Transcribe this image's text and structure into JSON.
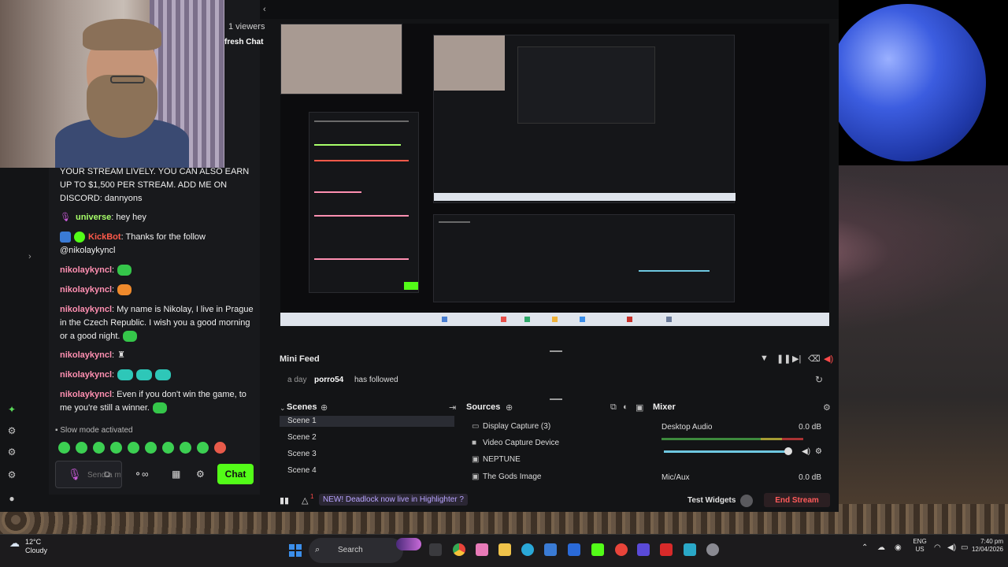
{
  "chat": {
    "viewers": "1 viewers",
    "refresh_label": "fresh Chat",
    "messages": {
      "m0": {
        "text": "YOUR STREAM LIVELY. YOU CAN ALSO EARN UP TO $1,500 PER STREAM. ADD ME ON DISCORD: dannyons"
      },
      "m1": {
        "user": "universe",
        "text": ": hey hey"
      },
      "m2": {
        "user": "KickBot",
        "text": ": Thanks for the follow @nikolaykyncl"
      },
      "m3": {
        "user": "nikolaykyncl",
        "text": ":"
      },
      "m4": {
        "user": "nikolaykyncl",
        "text": ":"
      },
      "m5": {
        "user": "nikolaykyncl",
        "text": ": My name is Nikolay, I live in Prague in the Czech Republic. I wish you a good morning or a good night."
      },
      "m6": {
        "user": "nikolaykyncl",
        "text": ":"
      },
      "m7": {
        "user": "nikolaykyncl",
        "text": ":"
      },
      "m8": {
        "user": "nikolaykyncl",
        "text": ": Even if you don't win the game, to me you're still a winner."
      }
    },
    "slow_mode": "Slow mode activated",
    "input_placeholder": "Send a message",
    "chat_button": "Chat"
  },
  "minifeed": {
    "title": "Mini Feed",
    "time": "a day",
    "user": "porro54",
    "action": "has followed"
  },
  "scenes": {
    "title": "Scenes",
    "items": [
      "Scene 1",
      "Scene 2",
      "Scene 3",
      "Scene 4"
    ],
    "selected": "Scene 1"
  },
  "sources": {
    "title": "Sources",
    "items": [
      "Display Capture (3)",
      "Video Capture Device",
      "NEPTUNE",
      "The Gods Image"
    ]
  },
  "mixer": {
    "title": "Mixer",
    "channels": [
      {
        "name": "Desktop Audio",
        "db": "0.0 dB"
      },
      {
        "name": "Mic/Aux",
        "db": "0.0 dB"
      }
    ]
  },
  "bottom": {
    "highlighter": "NEW! Deadlock now live in Highlighter ?",
    "test_widgets": "Test Widgets",
    "end_stream": "End Stream"
  },
  "taskbar": {
    "temp": "12°C",
    "condition": "Cloudy",
    "search": "Search",
    "lang_top": "ENG",
    "lang_bottom": "US",
    "time": "7:40 pm",
    "date": "12/04/2026"
  },
  "colors": {
    "kick_green": "#53fc18",
    "end_stream_red": "#ff5a5a",
    "accent_blue": "#3b8eea"
  }
}
